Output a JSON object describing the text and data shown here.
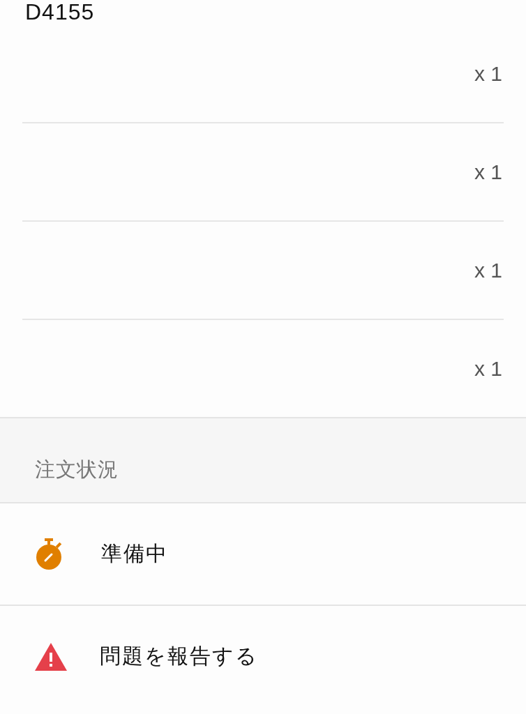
{
  "order_number": "D4155",
  "items": [
    {
      "quantity": "x 1"
    },
    {
      "quantity": "x 1"
    },
    {
      "quantity": "x 1"
    },
    {
      "quantity": "x 1"
    }
  ],
  "status_section": {
    "title": "注文状況"
  },
  "status_rows": [
    {
      "kind": "status",
      "label": "準備中"
    },
    {
      "kind": "report",
      "label": "問題を報告する"
    }
  ]
}
